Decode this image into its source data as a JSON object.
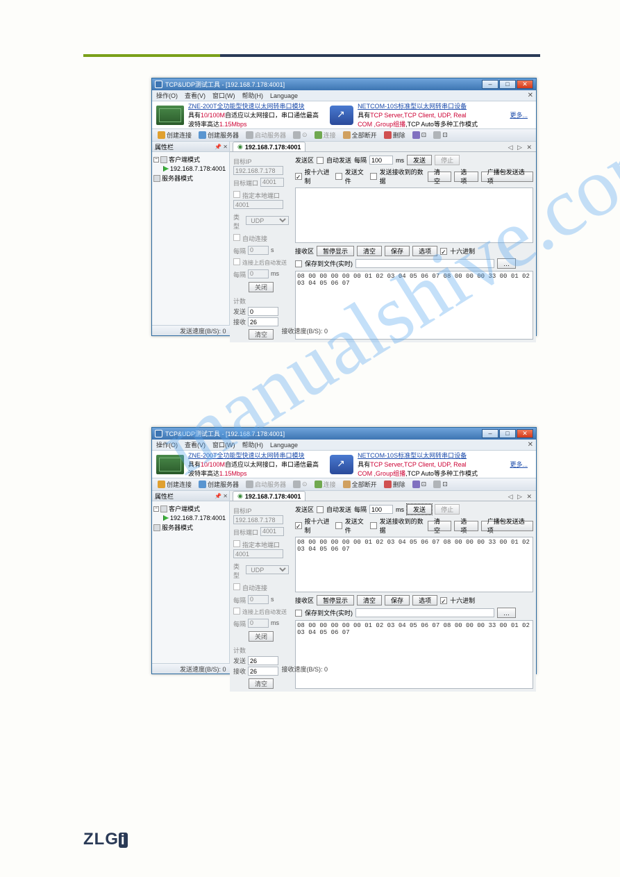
{
  "title_full": "TCP&UDP测试工具 - [192.168.7.178:4001]",
  "menus": {
    "op": "操作(O)",
    "view": "查看(V)",
    "win": "窗口(W)",
    "help": "帮助(H)",
    "lang": "Language"
  },
  "banner": {
    "link1": "ZNE-200T全功能型快速以太网转串口模块",
    "sub1a": "具有",
    "sub1b": "10/100M",
    "sub1c": "自适应以太网接口，串口通信最高",
    "sub1d": "波特率高达",
    "sub1e": "1.15Mbps",
    "link2": "NETCOM-10S标准型以太网转串口设备",
    "sub2a": "具有",
    "sub2b": "TCP Server,TCP Client, UDP, Real",
    "sub2c": "COM ,Group组播",
    "sub2d": ",TCP Auto",
    "sub2e": "等多种工作模式",
    "more": "更多..."
  },
  "toolbar": {
    "t1": "创建连接",
    "t2": "创建服务器",
    "t3": "启动服务器",
    "t4": "⊙",
    "t5": "连接",
    "t6": "全部断开",
    "t7": "删除",
    "t8": "⊡",
    "t9": "⊡"
  },
  "sidebar": {
    "head": "属性栏",
    "n1": "客户端模式",
    "n2": "192.168.7.178:4001",
    "n3": "服务器模式"
  },
  "tab": "192.168.7.178:4001",
  "left": {
    "ip_l": "目标IP",
    "ip": "192.168.7.178",
    "port_l": "目标端口",
    "port": "4001",
    "local_l": "指定本地端口",
    "local": "4001",
    "type_l": "类型",
    "type": "UDP",
    "auto_l": "自动连接",
    "every_l": "每隔",
    "every": "0",
    "every_u": "s",
    "auto2_l": "连接上后自动发送",
    "every2_l": "每隔",
    "every2": "0",
    "every2_u": "ms",
    "close": "关闭",
    "count_l": "计数",
    "send_l": "发送",
    "recv_l": "接收",
    "clear": "清空"
  },
  "a": {
    "send": "0",
    "recv": "26"
  },
  "b": {
    "send": "26",
    "recv": "26"
  },
  "right": {
    "sendarea": "发送区",
    "autosend": "自动发送",
    "every": "每隔",
    "interval": "100",
    "ms": "ms",
    "send": "发送",
    "stop": "停止",
    "hex": "按十六进制",
    "sendfile": "发送文件",
    "recvsend": "发送接收到的数据",
    "clear": "清空",
    "opt": "选项",
    "broad": "广播包发送选项",
    "recvarea": "接收区",
    "pause": "暂停显示",
    "save": "保存",
    "savefile": "保存到文件(实时)",
    "hex2": "十六进制",
    "hexdata": "08 00 00 00 00 00 01 02 03 04 05 06 07 08 00 00 00 33 00 01 02 03 04 05 06 07"
  },
  "status": {
    "tx": "发送速度(B/S): 0",
    "rx": "接收速度(B/S): 0"
  }
}
